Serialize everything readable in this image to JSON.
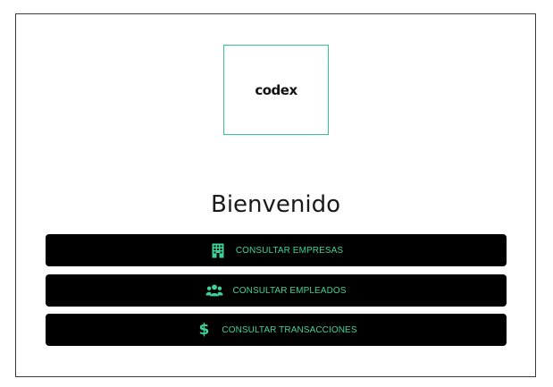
{
  "logo": {
    "text": "codex"
  },
  "welcome": {
    "title": "Bienvenido"
  },
  "buttons": [
    {
      "label": "CONSULTAR EMPRESAS",
      "icon": "building-icon"
    },
    {
      "label": "CONSULTAR EMPLEADOS",
      "icon": "users-icon"
    },
    {
      "label": "CONSULTAR TRANSACCIONES",
      "icon": "dollar-icon"
    }
  ],
  "colors": {
    "accent": "#3dd39a",
    "button_bg": "#000000",
    "logo_border": "#35c48f",
    "frame_border": "#3a3a3a"
  }
}
